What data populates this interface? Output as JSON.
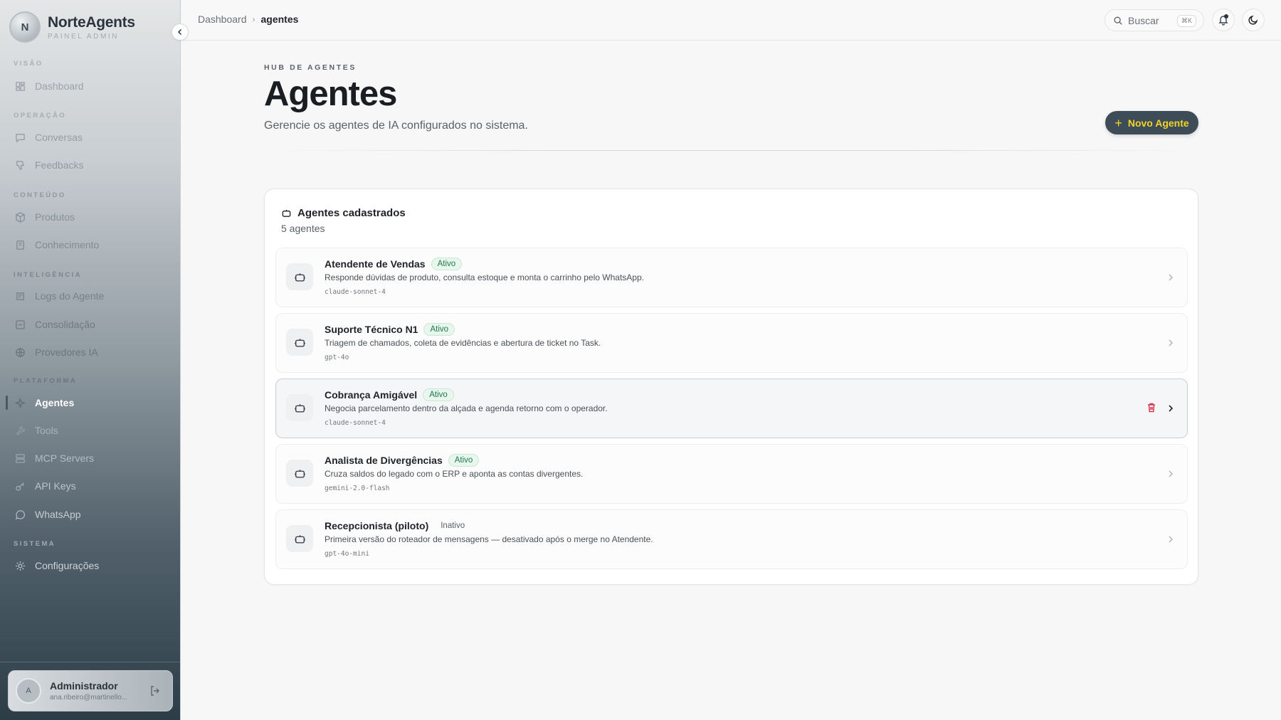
{
  "brand": {
    "logo_letter": "N",
    "name": "NorteAgents",
    "subtitle": "PAINEL ADMIN"
  },
  "sidebar": {
    "sections": [
      {
        "label": "VISÃO"
      },
      {
        "label": "OPERAÇÃO"
      },
      {
        "label": "CONTEÚDO"
      },
      {
        "label": "INTELIGÊNCIA"
      },
      {
        "label": "PLATAFORMA"
      },
      {
        "label": "SISTEMA"
      }
    ],
    "items": [
      {
        "label": "Dashboard",
        "icon": "dashboard-icon"
      },
      {
        "label": "Conversas",
        "icon": "message-icon"
      },
      {
        "label": "Feedbacks",
        "icon": "thumbs-down-icon"
      },
      {
        "label": "Produtos",
        "icon": "package-icon"
      },
      {
        "label": "Conhecimento",
        "icon": "book-icon"
      },
      {
        "label": "Logs do Agente",
        "icon": "logs-icon"
      },
      {
        "label": "Consolidação",
        "icon": "consolidation-icon"
      },
      {
        "label": "Provedores IA",
        "icon": "globe-icon"
      },
      {
        "label": "Agentes",
        "icon": "sparkle-icon",
        "active": true
      },
      {
        "label": "Tools",
        "icon": "wrench-icon"
      },
      {
        "label": "MCP Servers",
        "icon": "server-icon"
      },
      {
        "label": "API Keys",
        "icon": "key-icon"
      },
      {
        "label": "WhatsApp",
        "icon": "chat-bubble-icon"
      },
      {
        "label": "Configurações",
        "icon": "gear-icon"
      }
    ]
  },
  "user": {
    "avatar_letter": "A",
    "name": "Administrador",
    "email": "ana.ribeiro@martinello..."
  },
  "header": {
    "breadcrumb": [
      "Dashboard",
      "agentes"
    ],
    "search_label": "Buscar",
    "search_shortcut": "⌘K"
  },
  "page": {
    "eyebrow": "HUB DE AGENTES",
    "title": "Agentes",
    "subtitle": "Gerencie os agentes de IA configurados no sistema.",
    "new_button": "Novo Agente"
  },
  "card": {
    "title": "Agentes cadastrados",
    "count": "5 agentes",
    "agents": [
      {
        "name": "Atendente de Vendas",
        "status": "Ativo",
        "description": "Responde dúvidas de produto, consulta estoque e monta o carrinho pelo WhatsApp.",
        "model": "claude-sonnet-4"
      },
      {
        "name": "Suporte Técnico N1",
        "status": "Ativo",
        "description": "Triagem de chamados, coleta de evidências e abertura de ticket no Task.",
        "model": "gpt-4o"
      },
      {
        "name": "Cobrança Amigável",
        "status": "Ativo",
        "description": "Negocia parcelamento dentro da alçada e agenda retorno com o operador.",
        "model": "claude-sonnet-4"
      },
      {
        "name": "Analista de Divergências",
        "status": "Ativo",
        "description": "Cruza saldos do legado com o ERP e aponta as contas divergentes.",
        "model": "gemini-2.0-flash"
      },
      {
        "name": "Recepcionista (piloto)",
        "status": "Inativo",
        "description": "Primeira versão do roteador de mensagens — desativado após o merge no Atendente.",
        "model": "gpt-4o-mini"
      }
    ]
  },
  "colors": {
    "accent_button_bg": "#3d4c57",
    "accent_button_text": "#f2d52b",
    "status_active": "#1b7a4a",
    "delete": "#d9364f"
  }
}
